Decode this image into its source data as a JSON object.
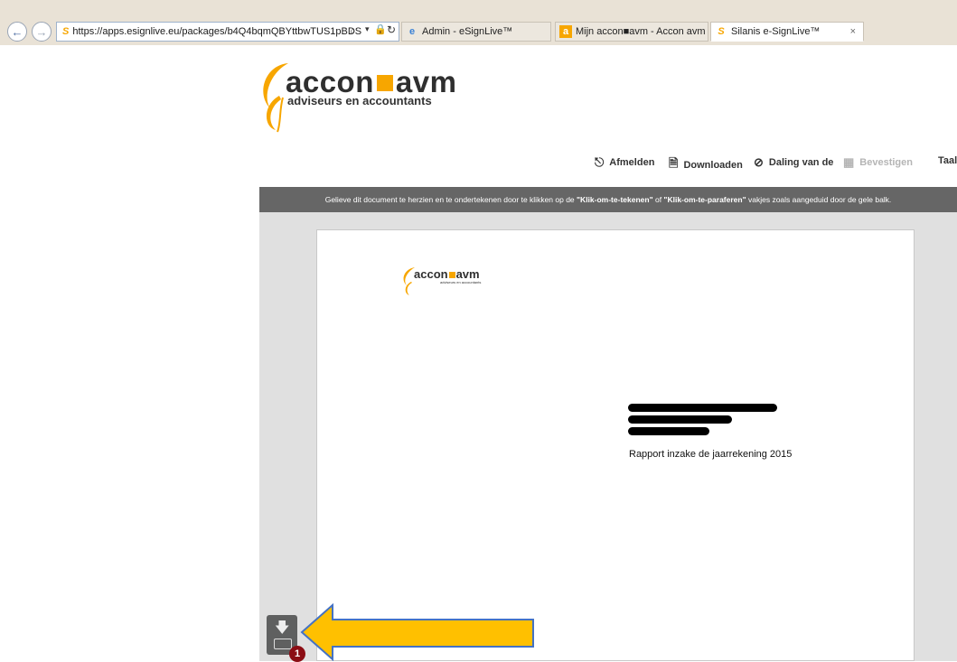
{
  "browser": {
    "address_url": "https://apps.esignlive.eu/packages/b4Q4bqmQBYttbwTUS1pBDS",
    "tabs": [
      {
        "label": "Admin - eSignLive™"
      },
      {
        "label": "Mijn accon■avm - Accon avm"
      },
      {
        "label": "Silanis e-SignLive™"
      }
    ],
    "close_glyph": "×",
    "back_icon": "back-arrow-icon",
    "forward_icon": "forward-arrow-icon"
  },
  "logo": {
    "brand_left": "accon",
    "brand_right": "avm",
    "tagline": "adviseurs en accountants",
    "accent_color": "#f7a600"
  },
  "toolbar": {
    "items": [
      {
        "label": "Afmelden",
        "icon": "logout-icon"
      },
      {
        "label": "Downloaden",
        "icon": "download-icon"
      },
      {
        "label": "Daling van de",
        "icon": "decline-icon"
      },
      {
        "label": "Bevestigen",
        "icon": "confirm-icon",
        "disabled": true
      },
      {
        "label": "Taal",
        "icon": ""
      }
    ]
  },
  "banner": {
    "text_before": "Gelieve dit document te herzien en te ondertekenen door te klikken op de ",
    "bold1": "\"Klik-om-te-tekenen\"",
    "text_mid": " of ",
    "bold2": "\"Klik-om-te-paraferen\"",
    "text_after": " vakjes zoals aangeduid door de gele balk."
  },
  "document": {
    "logo_brand_left": "accon",
    "logo_brand_right": "avm",
    "logo_tagline": "adviseurs en accountants",
    "title": "Rapport inzake de jaarrekening 2015"
  },
  "widget": {
    "badge_count": "1"
  },
  "colors": {
    "banner_bg": "#666666",
    "arrow_fill": "#ffc000",
    "arrow_stroke": "#4472c4",
    "badge": "#8b0d14"
  }
}
